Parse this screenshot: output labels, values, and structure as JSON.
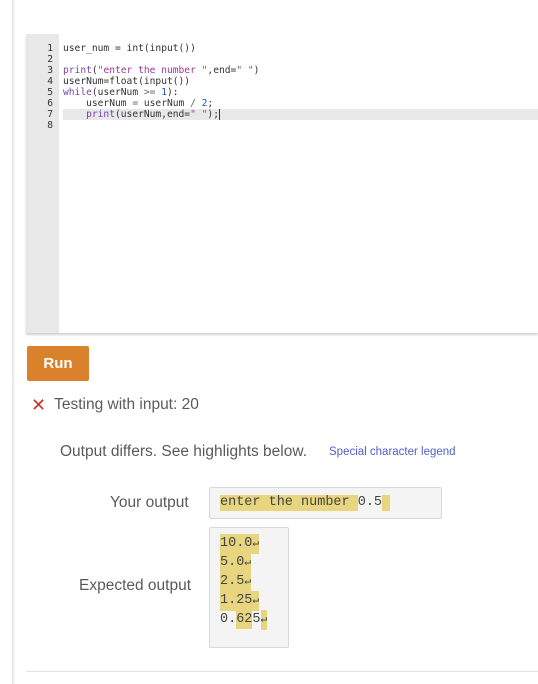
{
  "editor": {
    "lines": [
      {
        "num": "1",
        "tokens": [
          [
            "plain",
            "user_num = "
          ],
          [
            "plain",
            "int(input())"
          ]
        ]
      },
      {
        "num": "2",
        "tokens": []
      },
      {
        "num": "3",
        "tokens": [
          [
            "kw",
            "print"
          ],
          [
            "plain",
            "("
          ],
          [
            "str",
            "\"enter the number \""
          ],
          [
            "plain",
            ","
          ],
          [
            "plain",
            "end="
          ],
          [
            "str",
            "\" \""
          ],
          [
            "plain",
            ")"
          ]
        ]
      },
      {
        "num": "4",
        "tokens": [
          [
            "plain",
            "userNum=float(input())"
          ]
        ]
      },
      {
        "num": "5",
        "tokens": [
          [
            "kw",
            "while"
          ],
          [
            "plain",
            "(userNum "
          ],
          [
            "op",
            ">="
          ],
          [
            "plain",
            " "
          ],
          [
            "num",
            "1"
          ],
          [
            "plain",
            "):"
          ]
        ]
      },
      {
        "num": "6",
        "tokens": [
          [
            "plain",
            "    userNum "
          ],
          [
            "op",
            "="
          ],
          [
            "plain",
            " userNum "
          ],
          [
            "op",
            "/"
          ],
          [
            "plain",
            " "
          ],
          [
            "num",
            "2"
          ],
          [
            "plain",
            ";"
          ]
        ]
      },
      {
        "num": "7",
        "tokens": [
          [
            "plain",
            "    "
          ],
          [
            "kw",
            "print"
          ],
          [
            "plain",
            "(userNum,end="
          ],
          [
            "str",
            "\" \""
          ],
          [
            "plain",
            ");"
          ]
        ],
        "active": true
      },
      {
        "num": "8",
        "tokens": []
      }
    ]
  },
  "run_button": {
    "label": "Run"
  },
  "test": {
    "status_icon": "x-icon",
    "label": "Testing with input: 20"
  },
  "result": {
    "message": "Output differs. See highlights below.",
    "legend_link": "Special character legend"
  },
  "your_output": {
    "label": "Your output",
    "segments": [
      {
        "text": "enter the number ",
        "highlight": true
      },
      {
        "text": "0.5",
        "highlight": false
      },
      {
        "text": " ",
        "highlight": true
      }
    ]
  },
  "expected_output": {
    "label": "Expected output",
    "lines": [
      [
        {
          "text": "10.0↵",
          "highlight": true
        }
      ],
      [
        {
          "text": "5.0↵",
          "highlight": true
        }
      ],
      [
        {
          "text": "2.5↵",
          "highlight": true
        }
      ],
      [
        {
          "text": "1.25↵",
          "highlight": true
        }
      ],
      [
        {
          "text": "0.",
          "highlight": false
        },
        {
          "text": "62",
          "highlight": true
        },
        {
          "text": "5",
          "highlight": false
        },
        {
          "text": "↵",
          "highlight": true
        }
      ]
    ]
  },
  "colors": {
    "run_button": "#d9822b",
    "error_icon": "#d0312d",
    "diff_highlight": "#e8d57f",
    "link": "#5060c8"
  }
}
